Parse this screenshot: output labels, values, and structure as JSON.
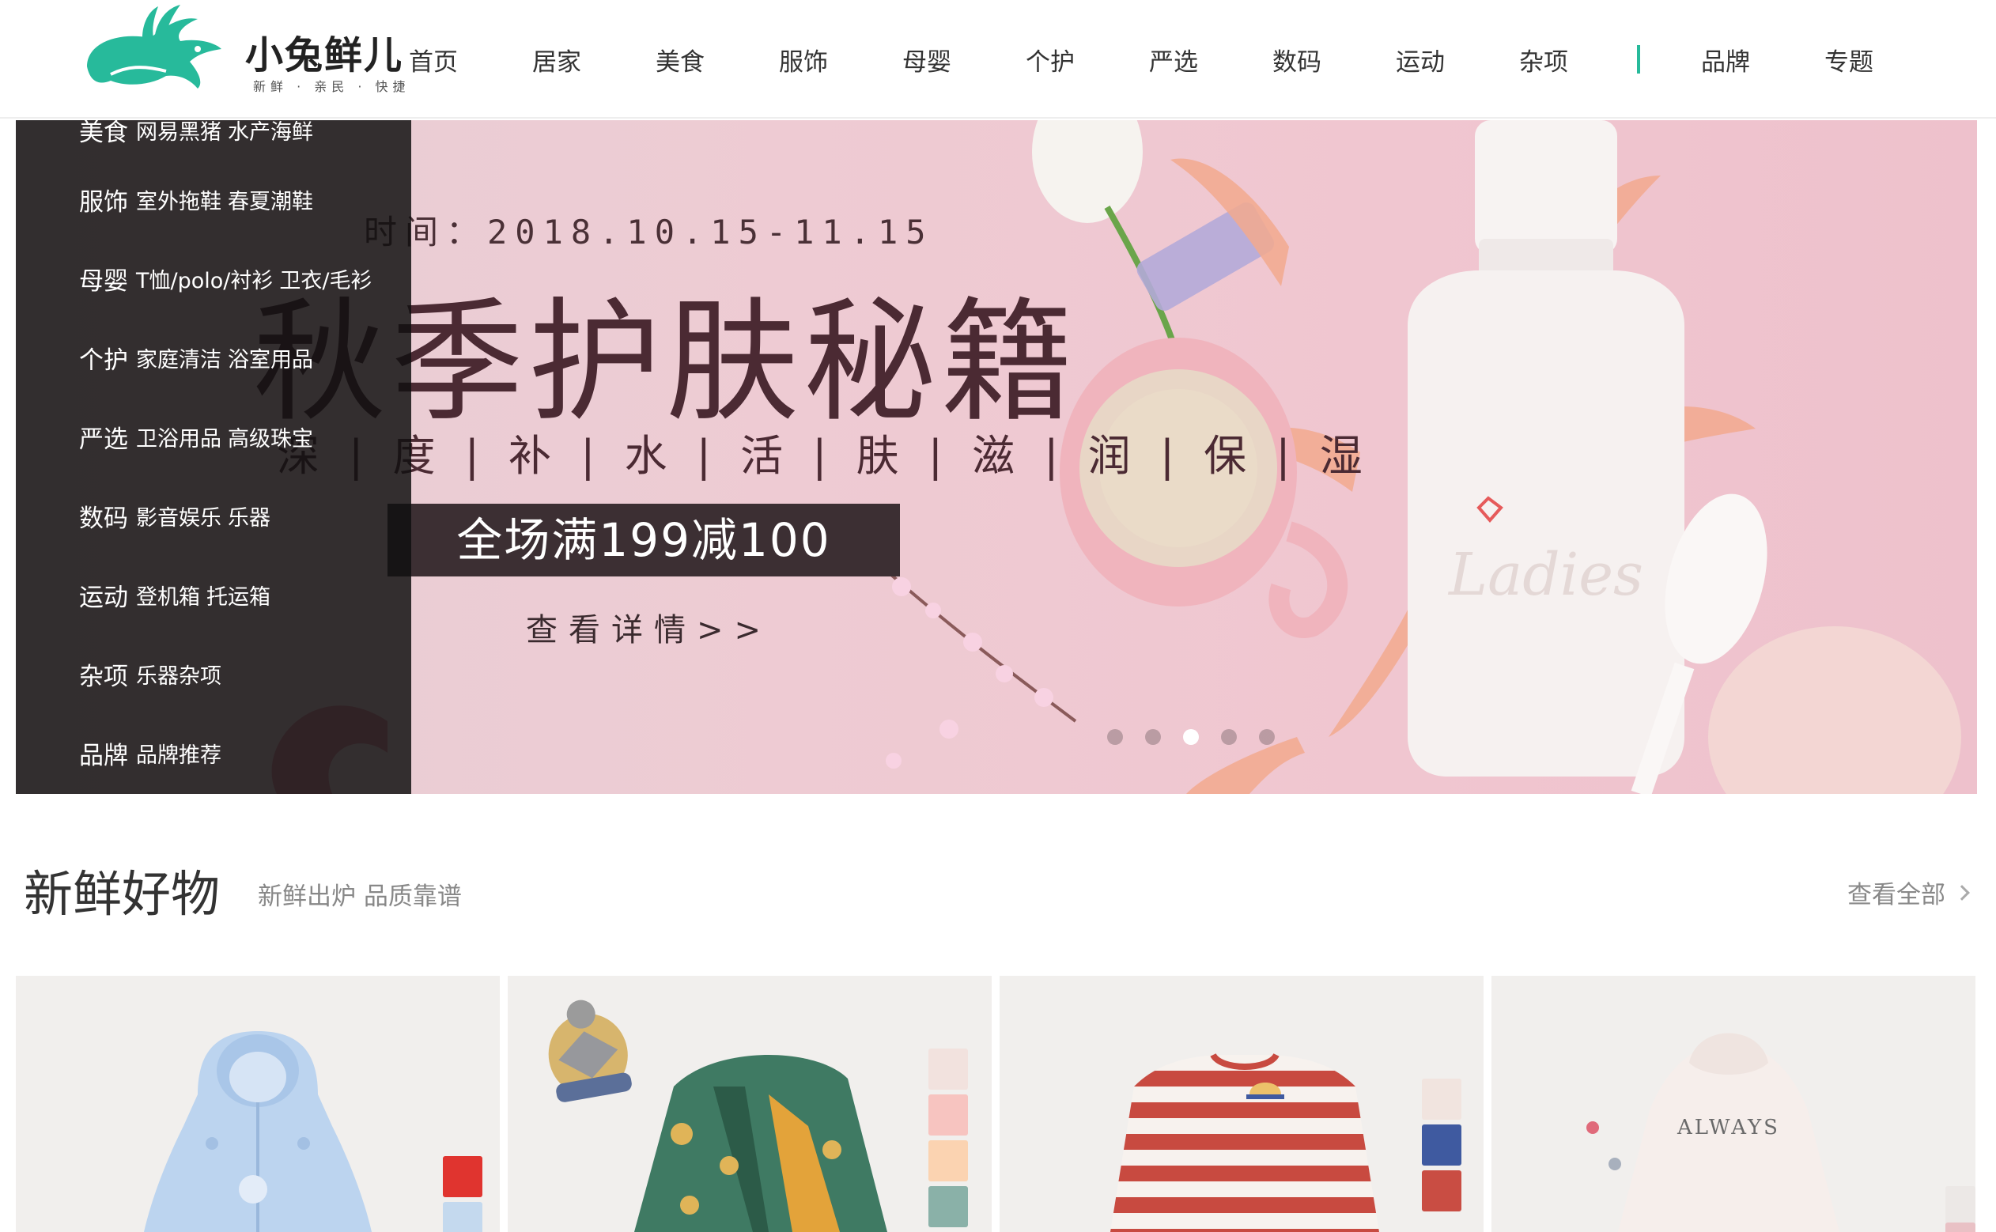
{
  "logo": {
    "text": "小兔鲜儿",
    "tagline": "新鲜 · 亲民 · 快捷"
  },
  "nav": {
    "items": [
      "首页",
      "居家",
      "美食",
      "服饰",
      "母婴",
      "个护",
      "严选",
      "数码",
      "运动",
      "杂项"
    ],
    "brand": "品牌",
    "topic": "专题",
    "accent_color": "#27ba9b"
  },
  "categories": [
    {
      "name": "美食",
      "subs": [
        "网易黑猪",
        "水产海鲜"
      ]
    },
    {
      "name": "服饰",
      "subs": [
        "室外拖鞋",
        "春夏潮鞋"
      ]
    },
    {
      "name": "母婴",
      "subs": [
        "T恤/polo/衬衫",
        "卫衣/毛衫"
      ]
    },
    {
      "name": "个护",
      "subs": [
        "家庭清洁",
        "浴室用品"
      ]
    },
    {
      "name": "严选",
      "subs": [
        "卫浴用品",
        "高级珠宝"
      ]
    },
    {
      "name": "数码",
      "subs": [
        "影音娱乐",
        "乐器"
      ]
    },
    {
      "name": "运动",
      "subs": [
        "登机箱",
        "托运箱"
      ]
    },
    {
      "name": "杂项",
      "subs": [
        "乐器杂项"
      ]
    },
    {
      "name": "品牌",
      "subs": [
        "品牌推荐"
      ]
    }
  ],
  "banner": {
    "date": "时间：2018.10.15-11.15",
    "title": "秋季护肤秘籍",
    "tags": "深 | 度 | 补 | 水 | 活 | 肤 | 滋 | 润 | 保 | 湿",
    "promo": "全场满199减100",
    "cta": "查看详情>>",
    "bottle_text": "Ladies",
    "slide_count": 5,
    "active_slide": 3
  },
  "section": {
    "title": "新鲜好物",
    "subtitle": "新鲜出炉 品质靠谱",
    "more": "查看全部"
  },
  "products": [
    {
      "icon": "baby-snowsuit-icon",
      "swatches": [
        "#e0342f",
        "#c4d9ee"
      ]
    },
    {
      "icon": "kids-puffer-jacket-icon",
      "swatches": [
        "#f2e2de",
        "#f7c4c0",
        "#fbd3b1",
        "#8ab1a8"
      ]
    },
    {
      "icon": "striped-sweater-icon",
      "swatches": [
        "#f1e4df",
        "#3f5aa0",
        "#c94d43"
      ]
    },
    {
      "icon": "kids-hoodie-icon",
      "swatches": [
        "#ece8e6",
        "#e9c1c5"
      ],
      "print": "ALWAYS"
    }
  ]
}
